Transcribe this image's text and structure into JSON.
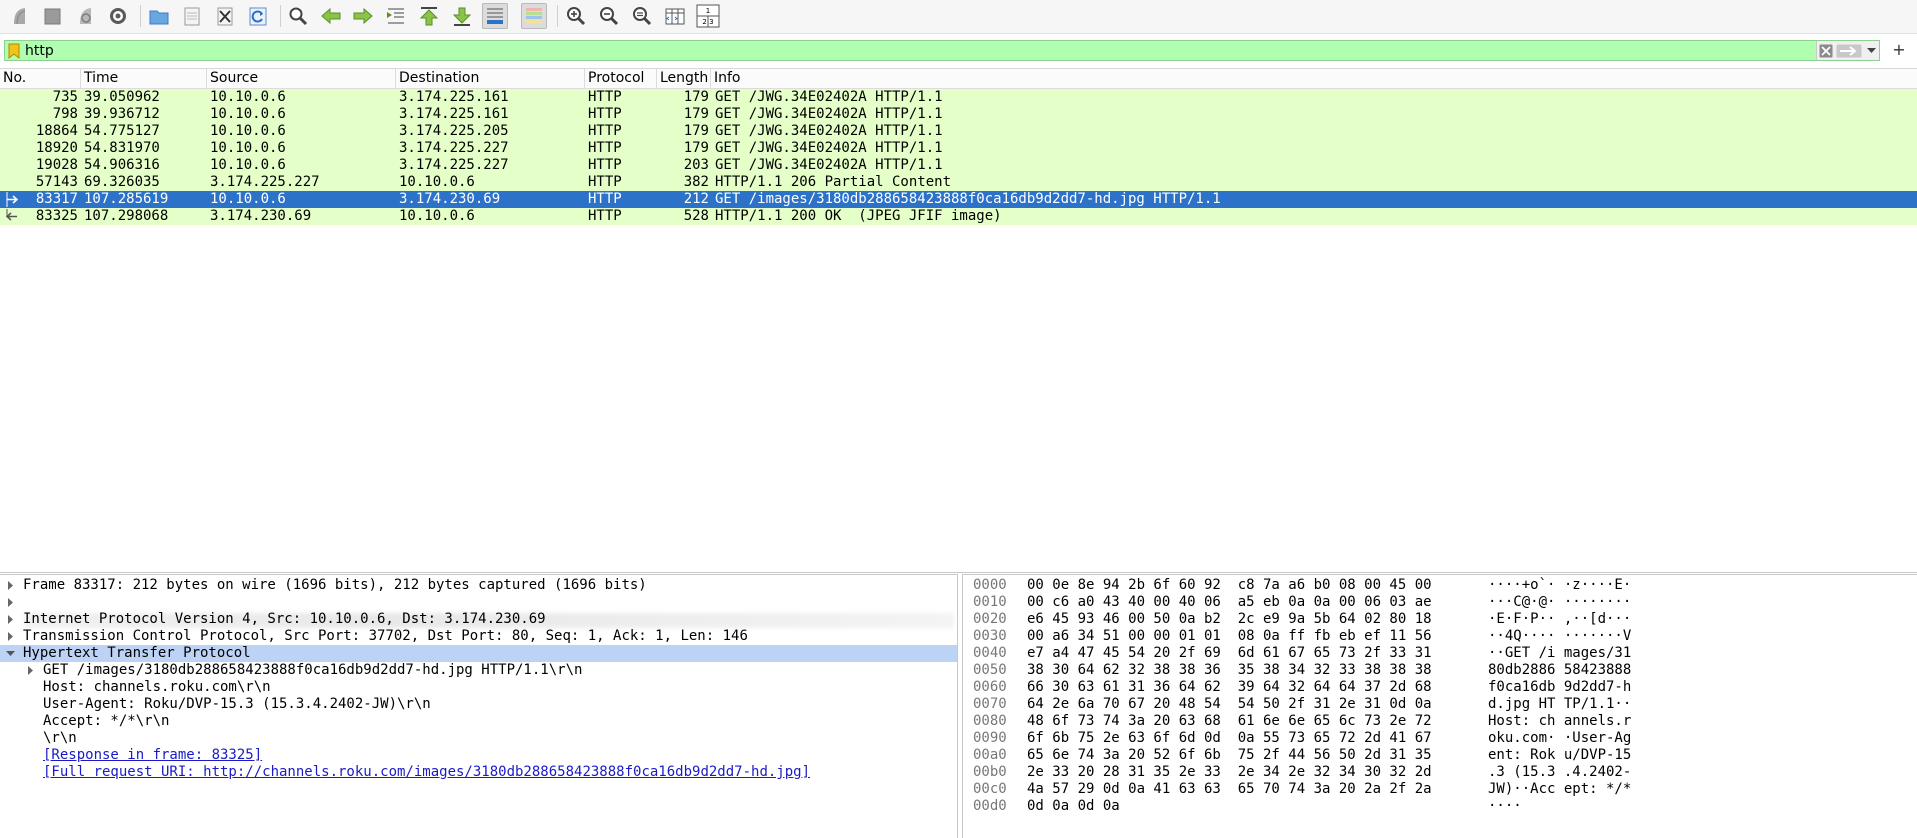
{
  "toolbar": {
    "buttons": [
      {
        "name": "start-capture-icon",
        "label": "Start capture"
      },
      {
        "name": "stop-capture-icon",
        "label": "Stop capture"
      },
      {
        "name": "restart-capture-icon",
        "label": "Restart capture"
      },
      {
        "name": "capture-options-icon",
        "label": "Capture options"
      },
      {
        "name": "open-file-icon",
        "label": "Open"
      },
      {
        "name": "save-file-icon",
        "label": "Save"
      },
      {
        "name": "close-file-icon",
        "label": "Close"
      },
      {
        "name": "reload-file-icon",
        "label": "Reload"
      },
      {
        "name": "find-packet-icon",
        "label": "Find packet"
      },
      {
        "name": "go-back-icon",
        "label": "Back"
      },
      {
        "name": "go-forward-icon",
        "label": "Forward"
      },
      {
        "name": "go-to-packet-icon",
        "label": "Go to packet"
      },
      {
        "name": "go-first-icon",
        "label": "First packet"
      },
      {
        "name": "go-last-icon",
        "label": "Last packet"
      },
      {
        "name": "auto-scroll-icon",
        "label": "Auto scroll"
      },
      {
        "name": "colorize-icon",
        "label": "Colorize"
      },
      {
        "name": "zoom-in-icon",
        "label": "Zoom in"
      },
      {
        "name": "zoom-out-icon",
        "label": "Zoom out"
      },
      {
        "name": "zoom-reset-icon",
        "label": "Normal size"
      },
      {
        "name": "resize-columns-icon",
        "label": "Resize columns"
      },
      {
        "name": "layout-icon",
        "label": "Layout"
      }
    ],
    "layout_glyph_top": "1",
    "layout_glyph_bottom": "2 3"
  },
  "filter": {
    "value": "http",
    "plus": "+"
  },
  "columns": [
    "No.",
    "Time",
    "Source",
    "Destination",
    "Protocol",
    "Length",
    "Info"
  ],
  "packets": [
    {
      "no": "735",
      "time": "39.050962",
      "src": "10.10.0.6",
      "dst": "3.174.225.161",
      "proto": "HTTP",
      "len": "179",
      "info": "GET /JWG.34E02402A HTTP/1.1",
      "selected": false,
      "rel": ""
    },
    {
      "no": "798",
      "time": "39.936712",
      "src": "10.10.0.6",
      "dst": "3.174.225.161",
      "proto": "HTTP",
      "len": "179",
      "info": "GET /JWG.34E02402A HTTP/1.1",
      "selected": false,
      "rel": ""
    },
    {
      "no": "18864",
      "time": "54.775127",
      "src": "10.10.0.6",
      "dst": "3.174.225.205",
      "proto": "HTTP",
      "len": "179",
      "info": "GET /JWG.34E02402A HTTP/1.1",
      "selected": false,
      "rel": ""
    },
    {
      "no": "18920",
      "time": "54.831970",
      "src": "10.10.0.6",
      "dst": "3.174.225.227",
      "proto": "HTTP",
      "len": "179",
      "info": "GET /JWG.34E02402A HTTP/1.1",
      "selected": false,
      "rel": ""
    },
    {
      "no": "19028",
      "time": "54.906316",
      "src": "10.10.0.6",
      "dst": "3.174.225.227",
      "proto": "HTTP",
      "len": "203",
      "info": "GET /JWG.34E02402A HTTP/1.1",
      "selected": false,
      "rel": ""
    },
    {
      "no": "57143",
      "time": "69.326035",
      "src": "3.174.225.227",
      "dst": "10.10.0.6",
      "proto": "HTTP",
      "len": "382",
      "info": "HTTP/1.1 206 Partial Content",
      "selected": false,
      "rel": ""
    },
    {
      "no": "83317",
      "time": "107.285619",
      "src": "10.10.0.6",
      "dst": "3.174.230.69",
      "proto": "HTTP",
      "len": "212",
      "info": "GET /images/3180db288658423888f0ca16db9d2dd7-hd.jpg HTTP/1.1",
      "selected": true,
      "rel": "request"
    },
    {
      "no": "83325",
      "time": "107.298068",
      "src": "3.174.230.69",
      "dst": "10.10.0.6",
      "proto": "HTTP",
      "len": "528",
      "info": "HTTP/1.1 200 OK  (JPEG JFIF image)",
      "selected": false,
      "rel": "response"
    }
  ],
  "details": [
    {
      "indent": 0,
      "tri": "right",
      "text": "Frame 83317: 212 bytes on wire (1696 bits), 212 bytes captured (1696 bits)",
      "link": false,
      "selected": false
    },
    {
      "indent": 0,
      "tri": "right",
      "text": "",
      "link": false,
      "selected": false,
      "blurred": true
    },
    {
      "indent": 0,
      "tri": "right",
      "text": "Internet Protocol Version 4, Src: 10.10.0.6, Dst: 3.174.230.69",
      "link": false,
      "selected": false
    },
    {
      "indent": 0,
      "tri": "right",
      "text": "Transmission Control Protocol, Src Port: 37702, Dst Port: 80, Seq: 1, Ack: 1, Len: 146",
      "link": false,
      "selected": false
    },
    {
      "indent": 0,
      "tri": "down",
      "text": "Hypertext Transfer Protocol",
      "link": false,
      "selected": true
    },
    {
      "indent": 1,
      "tri": "right",
      "text": "GET /images/3180db288658423888f0ca16db9d2dd7-hd.jpg HTTP/1.1\\r\\n",
      "link": false,
      "selected": false
    },
    {
      "indent": 1,
      "tri": "",
      "text": "Host: channels.roku.com\\r\\n",
      "link": false,
      "selected": false
    },
    {
      "indent": 1,
      "tri": "",
      "text": "User-Agent: Roku/DVP-15.3 (15.3.4.2402-JW)\\r\\n",
      "link": false,
      "selected": false
    },
    {
      "indent": 1,
      "tri": "",
      "text": "Accept: */*\\r\\n",
      "link": false,
      "selected": false
    },
    {
      "indent": 1,
      "tri": "",
      "text": "\\r\\n",
      "link": false,
      "selected": false
    },
    {
      "indent": 1,
      "tri": "",
      "text": "[Response in frame: 83325]",
      "link": true,
      "selected": false
    },
    {
      "indent": 1,
      "tri": "",
      "text": "[Full request URI: http://channels.roku.com/images/3180db288658423888f0ca16db9d2dd7-hd.jpg]",
      "link": true,
      "selected": false
    }
  ],
  "bytes": [
    {
      "off": "0000",
      "hex": "00 0e 8e 94 2b 6f 60 92  c8 7a a6 b0 08 00 45 00",
      "ascii": "····+o`· ·z····E·"
    },
    {
      "off": "0010",
      "hex": "00 c6 a0 43 40 00 40 06  a5 eb 0a 0a 00 06 03 ae",
      "ascii": "···C@·@· ········"
    },
    {
      "off": "0020",
      "hex": "e6 45 93 46 00 50 0a b2  2c e9 9a 5b 64 02 80 18",
      "ascii": "·E·F·P·· ,··[d···"
    },
    {
      "off": "0030",
      "hex": "00 a6 34 51 00 00 01 01  08 0a ff fb eb ef 11 56",
      "ascii": "··4Q···· ·······V"
    },
    {
      "off": "0040",
      "hex": "e7 a4 47 45 54 20 2f 69  6d 61 67 65 73 2f 33 31",
      "ascii": "··GET /i mages/31"
    },
    {
      "off": "0050",
      "hex": "38 30 64 62 32 38 38 36  35 38 34 32 33 38 38 38",
      "ascii": "80db2886 58423888"
    },
    {
      "off": "0060",
      "hex": "66 30 63 61 31 36 64 62  39 64 32 64 64 37 2d 68",
      "ascii": "f0ca16db 9d2dd7-h"
    },
    {
      "off": "0070",
      "hex": "64 2e 6a 70 67 20 48 54  54 50 2f 31 2e 31 0d 0a",
      "ascii": "d.jpg HT TP/1.1··"
    },
    {
      "off": "0080",
      "hex": "48 6f 73 74 3a 20 63 68  61 6e 6e 65 6c 73 2e 72",
      "ascii": "Host: ch annels.r"
    },
    {
      "off": "0090",
      "hex": "6f 6b 75 2e 63 6f 6d 0d  0a 55 73 65 72 2d 41 67",
      "ascii": "oku.com· ·User-Ag"
    },
    {
      "off": "00a0",
      "hex": "65 6e 74 3a 20 52 6f 6b  75 2f 44 56 50 2d 31 35",
      "ascii": "ent: Rok u/DVP-15"
    },
    {
      "off": "00b0",
      "hex": "2e 33 20 28 31 35 2e 33  2e 34 2e 32 34 30 32 2d",
      "ascii": ".3 (15.3 .4.2402-"
    },
    {
      "off": "00c0",
      "hex": "4a 57 29 0d 0a 41 63 63  65 70 74 3a 20 2a 2f 2a",
      "ascii": "JW)··Acc ept: */*"
    },
    {
      "off": "00d0",
      "hex": "0d 0a 0d 0a",
      "ascii": "····"
    }
  ]
}
